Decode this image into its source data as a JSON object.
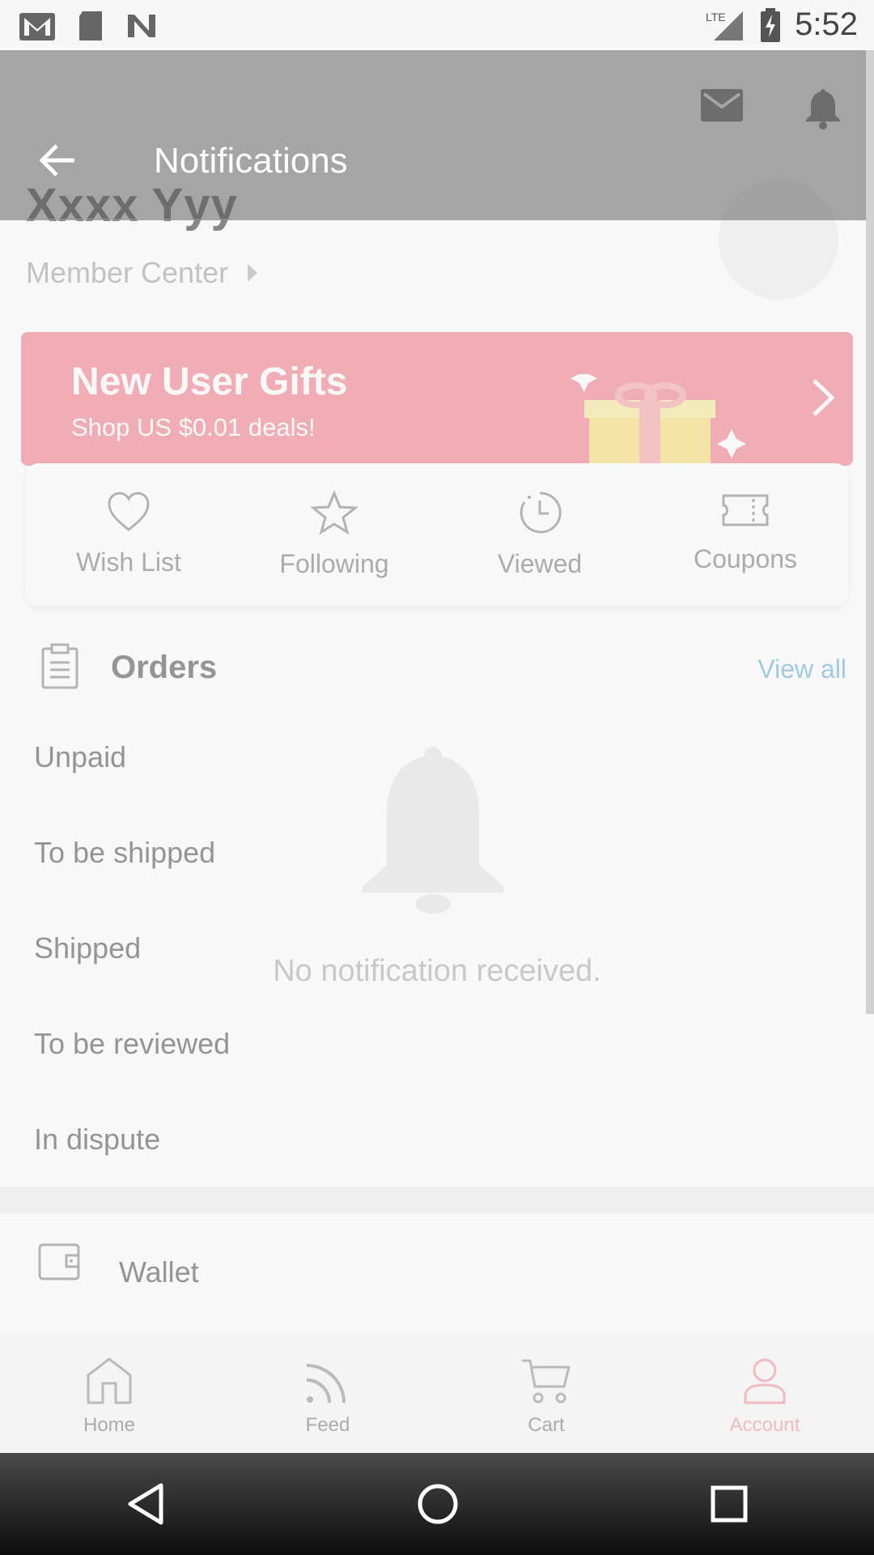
{
  "status_bar": {
    "time": "5:52",
    "network": "LTE",
    "left_icons": [
      "gmail-icon",
      "sd-card-icon",
      "n-app-icon"
    ],
    "right_icons": [
      "lte-signal-icon",
      "battery-charging-icon"
    ]
  },
  "account_page": {
    "top_icons": [
      "mail-icon",
      "bell-icon"
    ],
    "user_name": "Xxxx Yyy",
    "member_center": "Member Center",
    "promo": {
      "title": "New User Gifts",
      "subtitle": "Shop US $0.01 deals!",
      "color": "#ef5a6e"
    },
    "quick_links": [
      {
        "label": "Wish List",
        "icon": "heart-icon"
      },
      {
        "label": "Following",
        "icon": "star-icon"
      },
      {
        "label": "Viewed",
        "icon": "clock-icon"
      },
      {
        "label": "Coupons",
        "icon": "ticket-icon"
      }
    ],
    "orders": {
      "title": "Orders",
      "view_all": "View all",
      "rows": [
        "Unpaid",
        "To be shipped",
        "Shipped",
        "To be reviewed",
        "In dispute"
      ]
    },
    "wallet": {
      "label": "Wallet"
    }
  },
  "bottom_nav": {
    "items": [
      {
        "label": "Home",
        "icon": "home-icon"
      },
      {
        "label": "Feed",
        "icon": "feed-icon"
      },
      {
        "label": "Cart",
        "icon": "cart-icon"
      },
      {
        "label": "Account",
        "icon": "account-icon",
        "active": true
      }
    ],
    "active_color": "#f07686"
  },
  "notifications": {
    "title": "Notifications",
    "empty_message": "No notification received."
  },
  "android_nav": [
    "back-icon",
    "home-circle-icon",
    "recents-icon"
  ],
  "colors": {
    "accent_link": "#3a9ac9",
    "toolbar_overlay": "#8c8c8c"
  }
}
